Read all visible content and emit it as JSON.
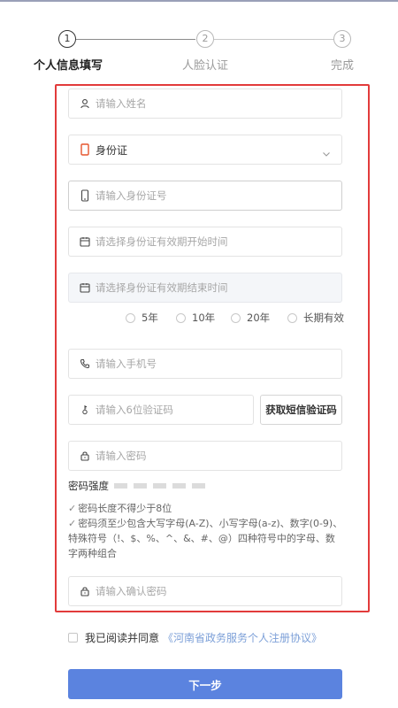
{
  "steps": [
    {
      "num": "1",
      "label": "个人信息填写"
    },
    {
      "num": "2",
      "label": "人脸认证"
    },
    {
      "num": "3",
      "label": "完成"
    }
  ],
  "form": {
    "name_placeholder": "请输入姓名",
    "id_type_value": "身份证",
    "id_number_placeholder": "请输入身份证号",
    "start_date_placeholder": "请选择身份证有效期开始时间",
    "end_date_placeholder": "请选择身份证有效期结束时间",
    "validity_options": [
      "5年",
      "10年",
      "20年",
      "长期有效"
    ],
    "phone_placeholder": "请输入手机号",
    "sms_code_placeholder": "请输入6位验证码",
    "sms_button": "获取短信验证码",
    "password_placeholder": "请输入密码",
    "strength_label": "密码强度",
    "rules": [
      "密码长度不得少于8位",
      "密码须至少包含大写字母(A-Z)、小写字母(a-z)、数字(0-9)、特殊符号（!、$、%、^、&、#、@）四种符号中的字母、数字两种组合"
    ],
    "confirm_password_placeholder": "请输入确认密码"
  },
  "agreement": {
    "text": "我已阅读并同意",
    "link": "《河南省政务服务个人注册协议》"
  },
  "next_button": "下一步",
  "colors": {
    "accent": "#5b83df",
    "highlight_border": "#e23b3b",
    "id_icon": "#e5552d",
    "link": "#7da0d8"
  }
}
